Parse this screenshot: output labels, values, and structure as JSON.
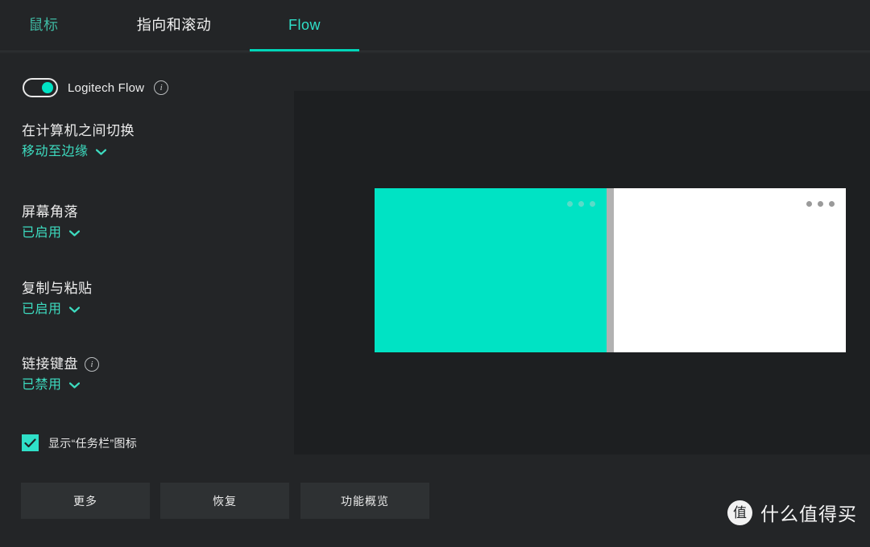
{
  "app": {
    "accent_color": "#00e3c4",
    "background_color": "#232527",
    "panel_color": "#1d1f21"
  },
  "tabs": [
    {
      "id": "mouse",
      "label": "鼠标",
      "active": false
    },
    {
      "id": "pointer",
      "label": "指向和滚动",
      "active": false
    },
    {
      "id": "flow",
      "label": "Flow",
      "active": true
    }
  ],
  "flow": {
    "toggle_label": "Logitech Flow",
    "toggle_state": "on",
    "info_glyph": "i"
  },
  "settings": [
    {
      "id": "switch-between-computers",
      "label": "在计算机之间切换",
      "value": "移动至边缘",
      "has_info": false
    },
    {
      "id": "screen-corners",
      "label": "屏幕角落",
      "value": "已启用",
      "has_info": false
    },
    {
      "id": "copy-and-paste",
      "label": "复制与粘贴",
      "value": "已启用",
      "has_info": false
    },
    {
      "id": "link-keyboard",
      "label": "链接键盘",
      "value": "已禁用",
      "has_info": true
    }
  ],
  "checkbox": {
    "label": "显示“任务栏”图标",
    "checked": true
  },
  "preview": {
    "left_screen_color": "#00e3c4",
    "right_screen_color": "#ffffff",
    "divider_color": "#b2b2b2",
    "dot_count": 3
  },
  "buttons": [
    {
      "id": "more",
      "label": "更多"
    },
    {
      "id": "restore",
      "label": "恢复"
    },
    {
      "id": "tour",
      "label": "功能概览"
    }
  ],
  "watermark": {
    "badge": "值",
    "text": "什么值得买"
  }
}
